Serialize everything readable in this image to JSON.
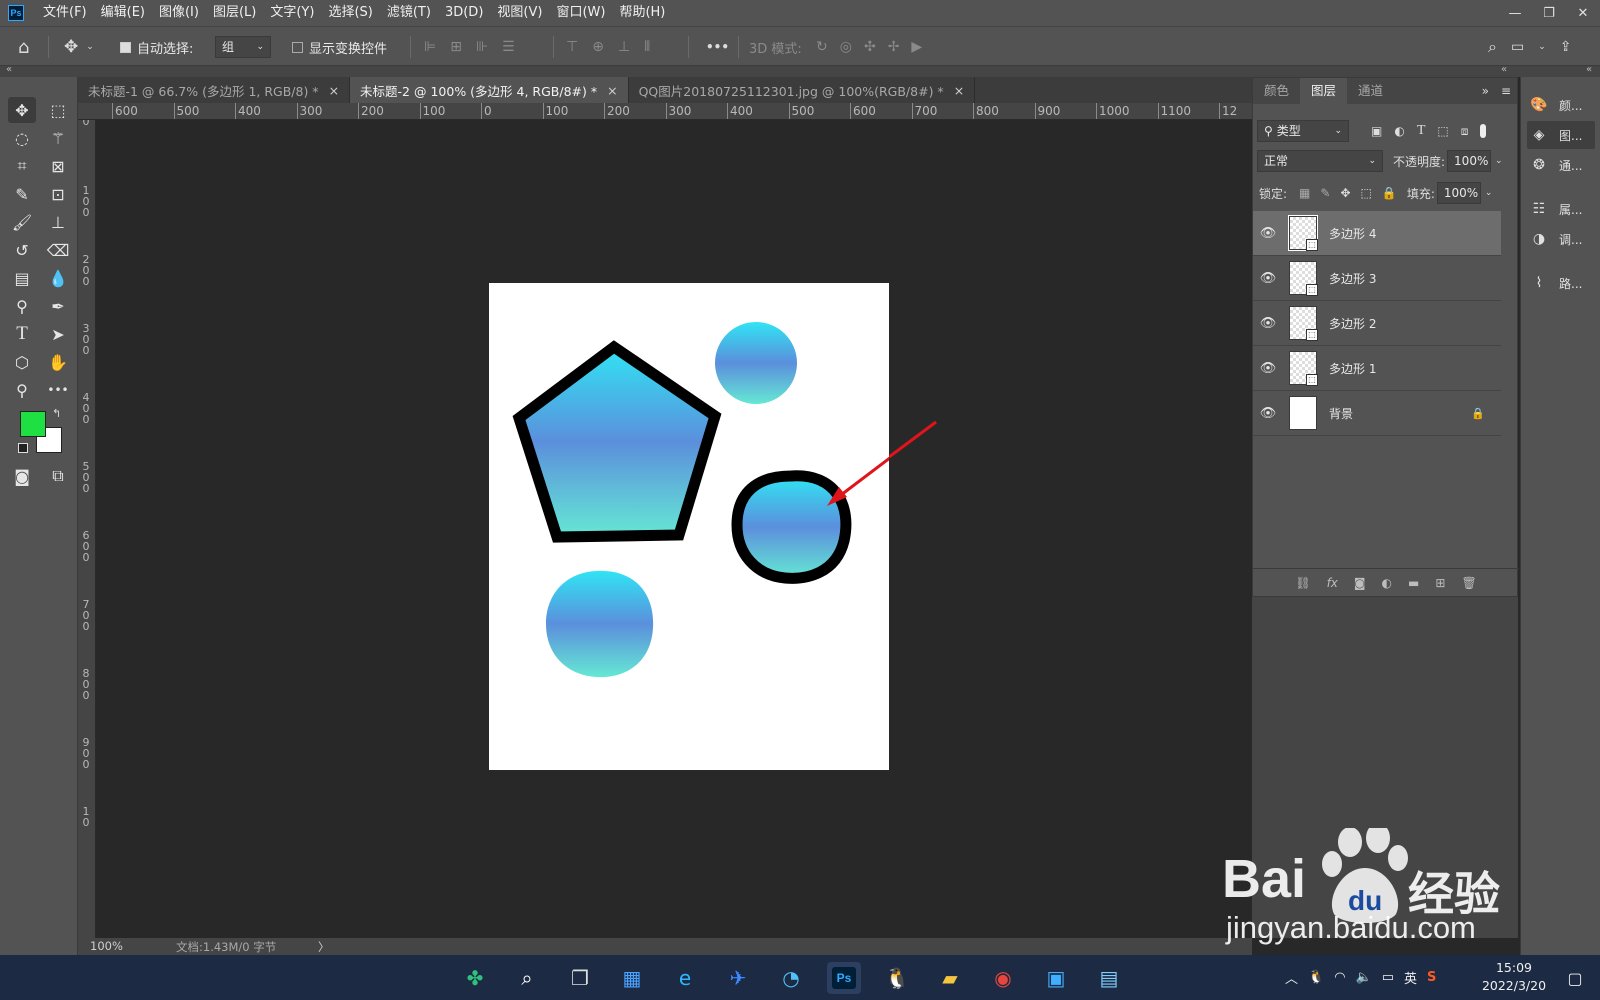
{
  "app": {
    "logo": "Ps"
  },
  "menu": [
    "文件(F)",
    "编辑(E)",
    "图像(I)",
    "图层(L)",
    "文字(Y)",
    "选择(S)",
    "滤镜(T)",
    "3D(D)",
    "视图(V)",
    "窗口(W)",
    "帮助(H)"
  ],
  "window_controls": {
    "minimize": "—",
    "restore": "❐",
    "close": "✕"
  },
  "options": {
    "auto_select_label": "自动选择:",
    "auto_select_value": "组",
    "show_transform_label": "显示变换控件",
    "mode_3d_label": "3D 模式:",
    "more": "•••"
  },
  "tabs": [
    {
      "label": "未标题-1 @ 66.7% (多边形 1, RGB/8) *",
      "close": "×"
    },
    {
      "label": "未标题-2 @ 100% (多边形 4, RGB/8#) *",
      "close": "×"
    },
    {
      "label": "QQ图片20180725112301.jpg @ 100%(RGB/8#) *",
      "close": "×"
    }
  ],
  "ruler_top": [
    "600",
    "500",
    "400",
    "300",
    "200",
    "100",
    "0",
    "100",
    "200",
    "300",
    "400",
    "500",
    "600",
    "700",
    "800",
    "900",
    "1000",
    "1100",
    "12"
  ],
  "ruler_left": [
    "0",
    "1\n0\n0",
    "2\n0\n0",
    "3\n0\n0",
    "4\n0\n0",
    "5\n0\n0",
    "6\n0\n0",
    "7\n0\n0",
    "8\n0\n0",
    "9\n0\n0",
    "1\n0"
  ],
  "status": {
    "zoom": "100%",
    "doc_info": "文档:1.43M/0 字节",
    "arrow": "〉"
  },
  "panel": {
    "tabs": [
      "颜色",
      "图层",
      "通道"
    ],
    "filter_label": "类型",
    "blend_mode": "正常",
    "opacity_label": "不透明度:",
    "opacity_value": "100%",
    "lock_label": "锁定:",
    "fill_label": "填充:",
    "fill_value": "100%",
    "layers": [
      {
        "name": "多边形 4"
      },
      {
        "name": "多边形 3"
      },
      {
        "name": "多边形 2"
      },
      {
        "name": "多边形 1"
      },
      {
        "name": "背景"
      }
    ]
  },
  "dock": [
    "颜...",
    "图...",
    "通...",
    "属...",
    "调...",
    "路..."
  ],
  "tray": {
    "ime": "英",
    "time": "15:09",
    "date": "2022/3/20"
  },
  "watermark": {
    "brand": "Bai",
    "brand_cn": "经验",
    "url": "jingyan.baidu.com"
  },
  "colors": {
    "foreground": "#1ee043",
    "background": "#ffffff",
    "gradient_top": "#30e4f4",
    "gradient_mid": "#5b8fdc",
    "gradient_bottom": "#65e8d4",
    "arrow": "#e0141b"
  }
}
